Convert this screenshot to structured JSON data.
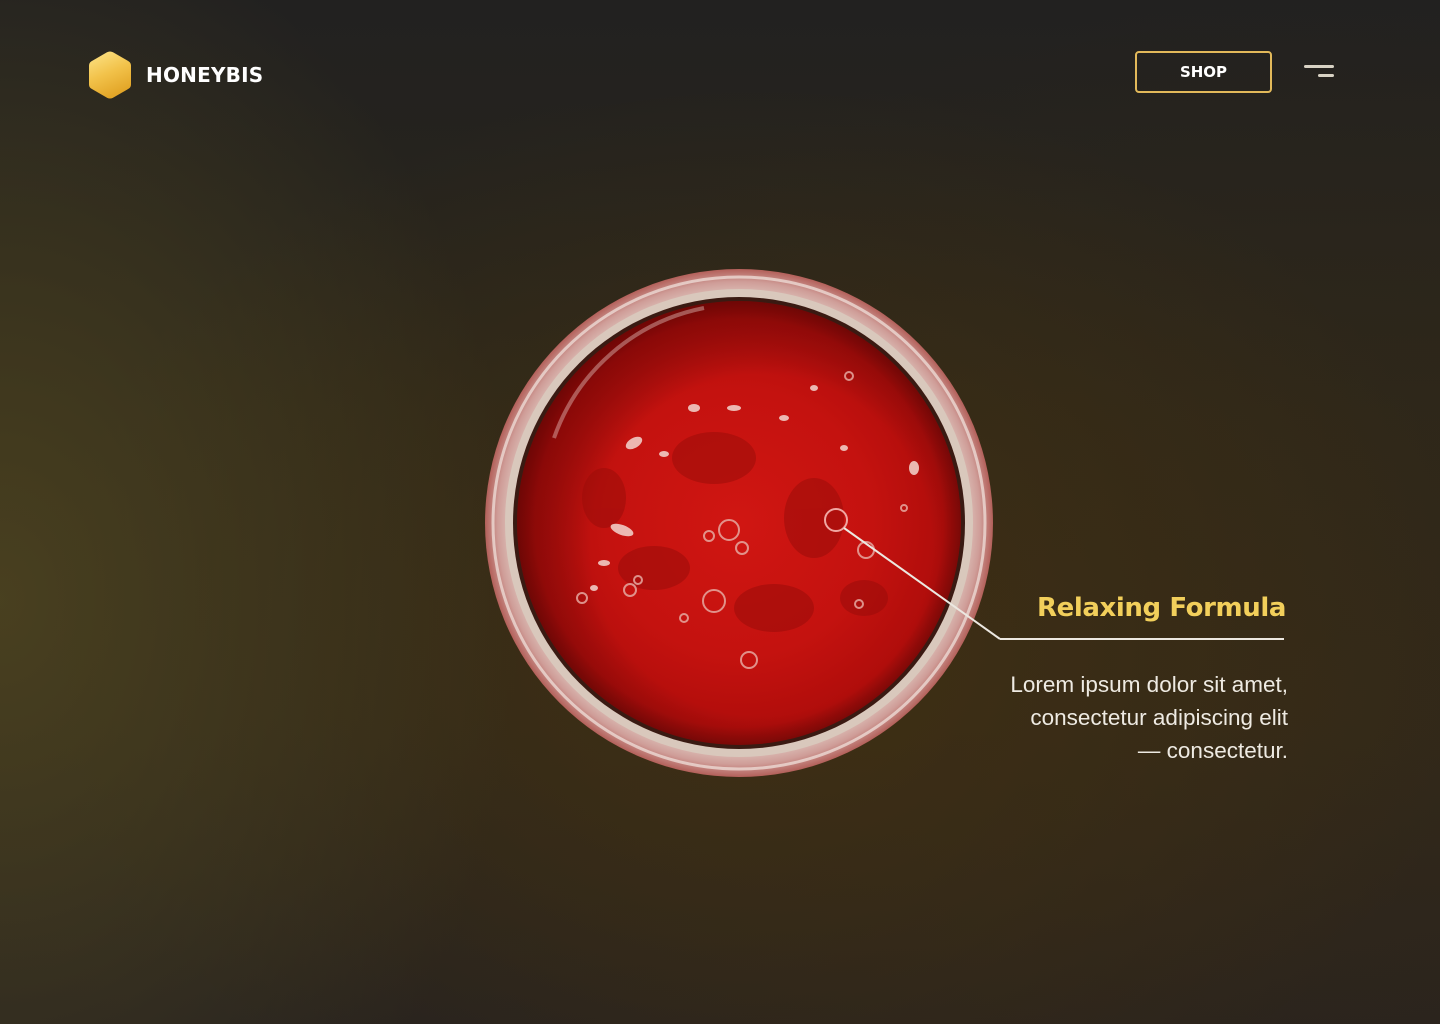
{
  "header": {
    "brand": "HONEYBIS",
    "logo_icon": "hexagon-icon",
    "shop_label": "SHOP",
    "menu_icon": "menu-icon"
  },
  "hero": {
    "image": "jar-of-red-jam-top-view",
    "callout": {
      "title": "Relaxing Formula",
      "description": "Lorem ipsum dolor sit amet,\nconsectetur adipiscing elit\n— consectetur."
    }
  },
  "colors": {
    "accent": "#f2cf5b",
    "button_border": "#e2b95a",
    "background": "#2a261b",
    "jam": "#c4120f"
  }
}
